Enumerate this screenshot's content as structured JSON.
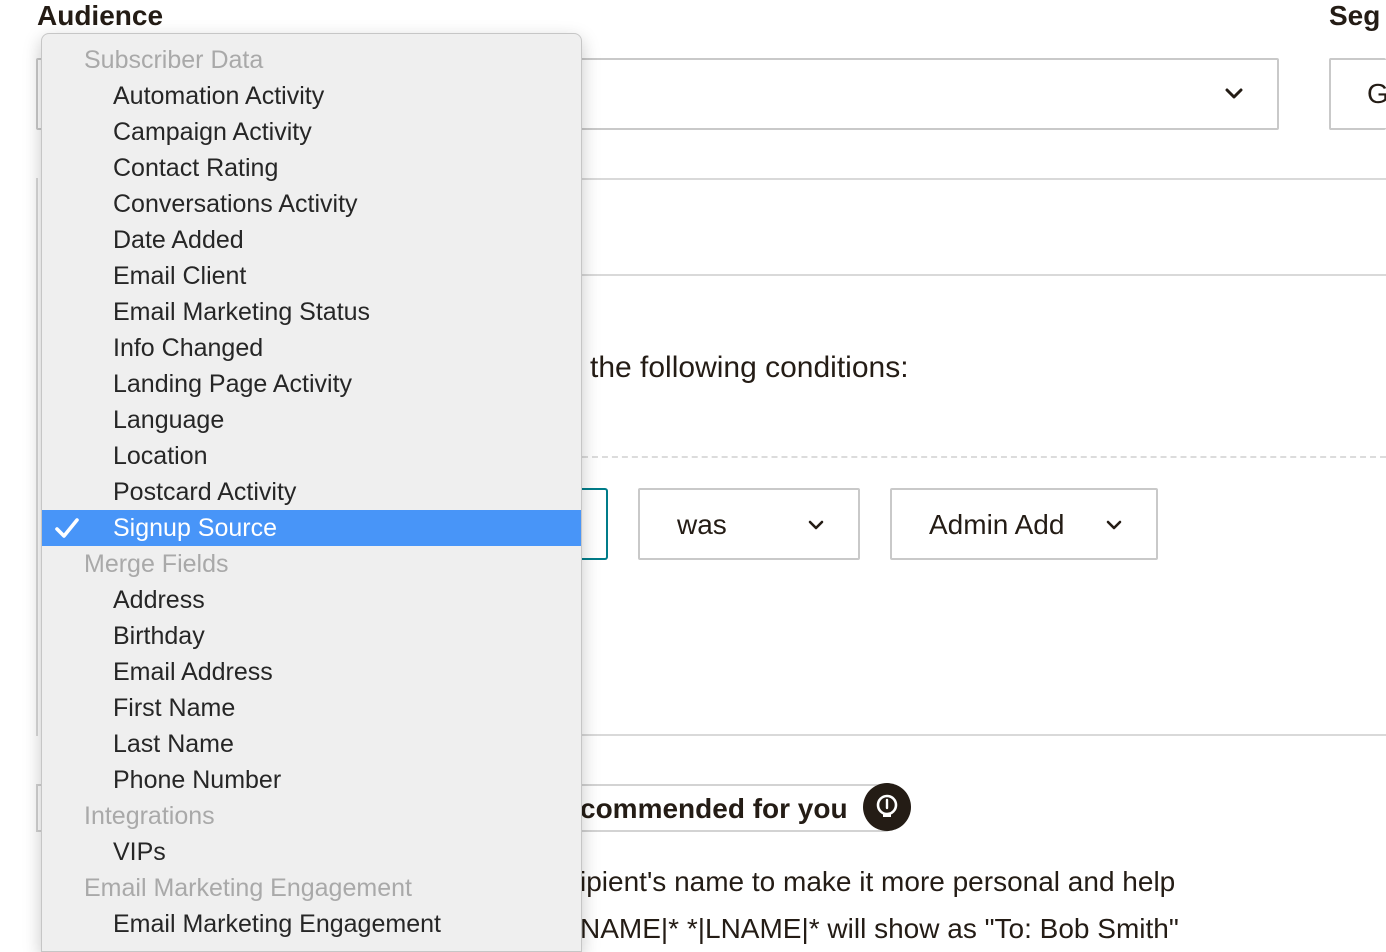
{
  "page": {
    "audience_label": "Audience",
    "segment_label": "Seg",
    "segment_select_partial": "G",
    "conditions_text": "the following conditions:",
    "condition_operator": "was",
    "condition_value": "Admin Add",
    "recommended_text": "commended for you",
    "body_line1": "ipient's name to make it more personal and help",
    "body_line2": "NAME|* *|LNAME|* will show as \"To: Bob Smith\""
  },
  "menu": {
    "rows": [
      {
        "type": "group",
        "label": "Subscriber Data"
      },
      {
        "type": "item",
        "label": "Automation Activity"
      },
      {
        "type": "item",
        "label": "Campaign Activity"
      },
      {
        "type": "item",
        "label": "Contact Rating"
      },
      {
        "type": "item",
        "label": "Conversations Activity"
      },
      {
        "type": "item",
        "label": "Date Added"
      },
      {
        "type": "item",
        "label": "Email Client"
      },
      {
        "type": "item",
        "label": "Email Marketing Status"
      },
      {
        "type": "item",
        "label": "Info Changed"
      },
      {
        "type": "item",
        "label": "Landing Page Activity"
      },
      {
        "type": "item",
        "label": "Language"
      },
      {
        "type": "item",
        "label": "Location"
      },
      {
        "type": "item",
        "label": "Postcard Activity"
      },
      {
        "type": "item",
        "label": "Signup Source",
        "selected": true
      },
      {
        "type": "group",
        "label": "Merge Fields"
      },
      {
        "type": "item",
        "label": "Address"
      },
      {
        "type": "item",
        "label": "Birthday"
      },
      {
        "type": "item",
        "label": "Email Address"
      },
      {
        "type": "item",
        "label": "First Name"
      },
      {
        "type": "item",
        "label": "Last Name"
      },
      {
        "type": "item",
        "label": "Phone Number"
      },
      {
        "type": "group",
        "label": "Integrations"
      },
      {
        "type": "item",
        "label": "VIPs"
      },
      {
        "type": "group",
        "label": "Email Marketing Engagement"
      },
      {
        "type": "item",
        "label": "Email Marketing Engagement"
      }
    ]
  },
  "colors": {
    "selection": "#4895f8",
    "text": "#241c15",
    "group_text": "#a9a9a9",
    "focus_border": "#007c89"
  },
  "icons": {
    "check": "checkmark-icon",
    "chevron": "chevron-down-icon",
    "bulb": "lightbulb-icon"
  }
}
